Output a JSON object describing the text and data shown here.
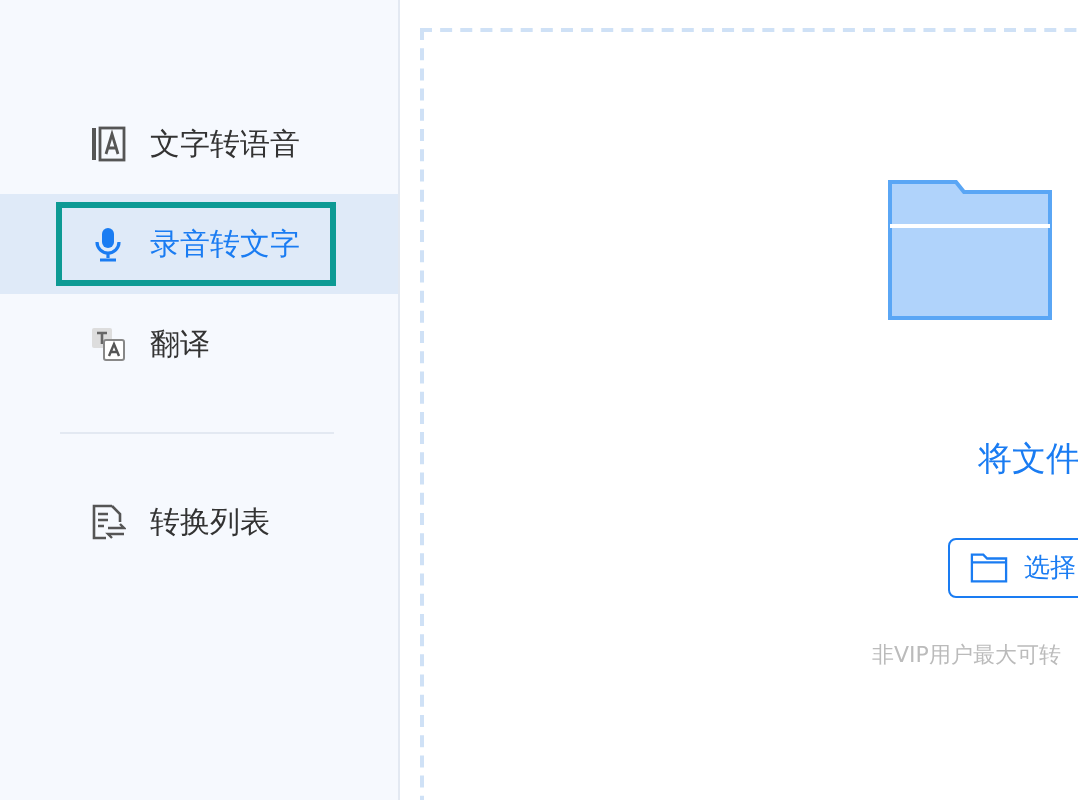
{
  "sidebar": {
    "items": [
      {
        "label": "文字转语音",
        "kind": "text-to-speech",
        "selected": false
      },
      {
        "label": "录音转文字",
        "kind": "speech-to-text",
        "selected": true
      },
      {
        "label": "翻译",
        "kind": "translate",
        "selected": false
      }
    ],
    "secondary_items": [
      {
        "label": "转换列表",
        "kind": "list",
        "selected": false
      }
    ]
  },
  "drop_zone": {
    "title": "将文件",
    "button": "选择",
    "note": "非VIP用户最大可转"
  }
}
